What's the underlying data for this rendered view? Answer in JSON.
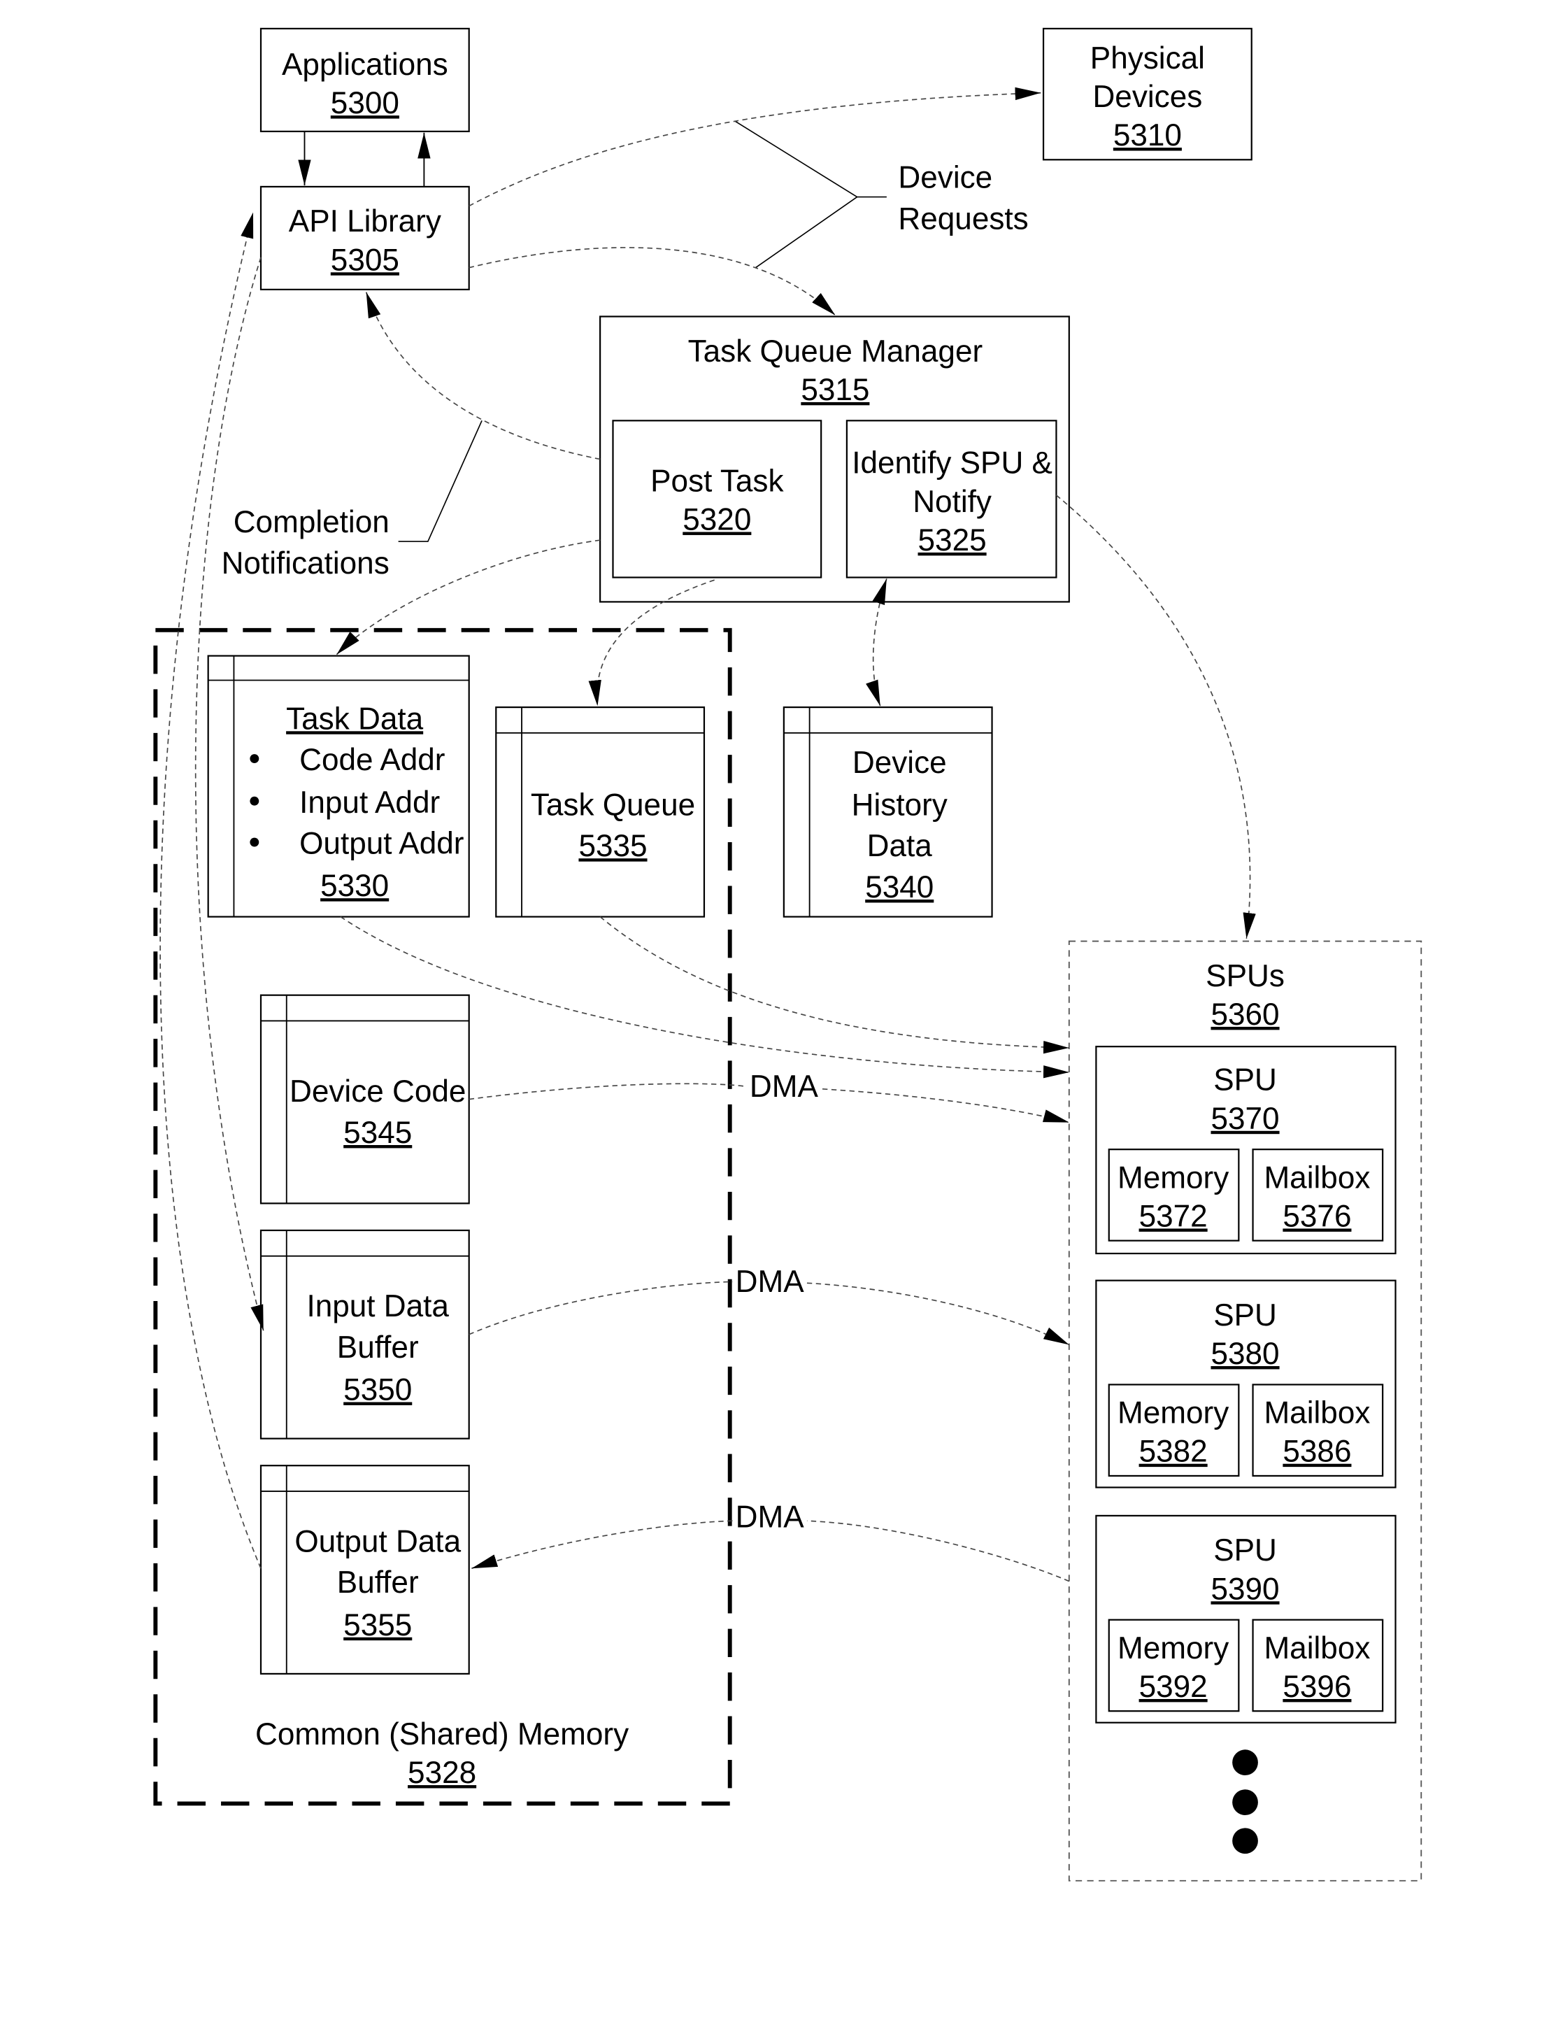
{
  "nodes": {
    "applications": {
      "label": "Applications",
      "ref": "5300"
    },
    "api_library": {
      "label": "API Library",
      "ref": "5305"
    },
    "physical_devices": {
      "label_lines": [
        "Physical",
        "Devices"
      ],
      "ref": "5310"
    },
    "task_queue_manager": {
      "label": "Task Queue Manager",
      "ref": "5315"
    },
    "post_task": {
      "label": "Post Task",
      "ref": "5320"
    },
    "identify_spu": {
      "label_lines": [
        "Identify SPU &",
        "Notify"
      ],
      "ref": "5325"
    },
    "common_memory": {
      "label": "Common (Shared) Memory",
      "ref": "5328"
    },
    "task_data": {
      "title": "Task Data",
      "items": [
        "Code Addr",
        "Input Addr",
        "Output Addr"
      ],
      "ref": "5330"
    },
    "task_queue": {
      "label": "Task Queue",
      "ref": "5335"
    },
    "device_history": {
      "label_lines": [
        "Device",
        "History",
        "Data"
      ],
      "ref": "5340"
    },
    "device_code": {
      "label": "Device Code",
      "ref": "5345"
    },
    "input_buffer": {
      "label_lines": [
        "Input Data",
        "Buffer"
      ],
      "ref": "5350"
    },
    "output_buffer": {
      "label_lines": [
        "Output Data",
        "Buffer"
      ],
      "ref": "5355"
    },
    "spus": {
      "label": "SPUs",
      "ref": "5360"
    },
    "spu_list": [
      {
        "label": "SPU",
        "ref": "5370",
        "memory": {
          "label": "Memory",
          "ref": "5372"
        },
        "mailbox": {
          "label": "Mailbox",
          "ref": "5376"
        }
      },
      {
        "label": "SPU",
        "ref": "5380",
        "memory": {
          "label": "Memory",
          "ref": "5382"
        },
        "mailbox": {
          "label": "Mailbox",
          "ref": "5386"
        }
      },
      {
        "label": "SPU",
        "ref": "5390",
        "memory": {
          "label": "Memory",
          "ref": "5392"
        },
        "mailbox": {
          "label": "Mailbox",
          "ref": "5396"
        }
      }
    ]
  },
  "annotations": {
    "device_requests": [
      "Device",
      "Requests"
    ],
    "completion_notifications": [
      "Completion",
      "Notifications"
    ],
    "dma_labels": [
      "DMA",
      "DMA",
      "DMA"
    ]
  }
}
